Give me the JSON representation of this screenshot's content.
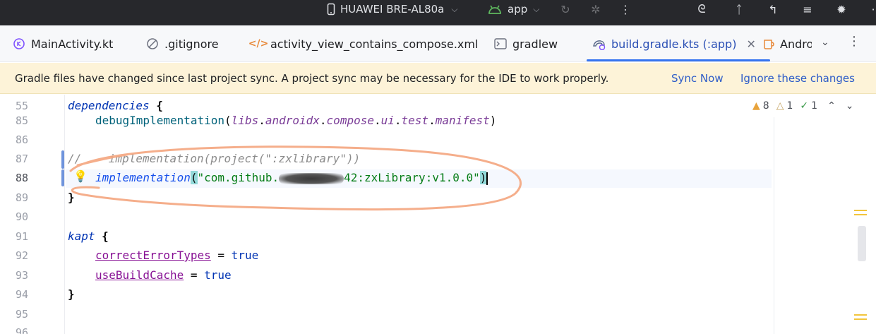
{
  "toolbar": {
    "device": "HUAWEI BRE-AL80a",
    "run_config": "app"
  },
  "tabs": [
    {
      "label": "MainActivity.kt",
      "icon": "kotlin-file-icon"
    },
    {
      "label": ".gitignore",
      "icon": "ignore-file-icon"
    },
    {
      "label": "activity_view_contains_compose.xml",
      "icon": "xml-file-icon"
    },
    {
      "label": "gradlew",
      "icon": "shell-file-icon"
    },
    {
      "label": "build.gradle.kts (:app)",
      "icon": "gradle-kotlin-file-icon",
      "active": true
    },
    {
      "label": "Andro",
      "icon": "android-manifest-icon"
    }
  ],
  "banner": {
    "message": "Gradle files have changed since last project sync. A project sync may be necessary for the IDE to work properly.",
    "sync_now": "Sync Now",
    "ignore": "Ignore these changes"
  },
  "inspections": {
    "warnings": "8",
    "weak_warnings": "1",
    "typos": "1"
  },
  "editor": {
    "line_numbers": [
      "55",
      "85",
      "86",
      "87",
      "88",
      "89",
      "90",
      "91",
      "92",
      "93",
      "94",
      "95",
      "96"
    ],
    "current_line": "88",
    "lines": {
      "l55": {
        "kw": "dependencies",
        "rest": " {"
      },
      "l85": {
        "fn": "debugImplementation",
        "open": "(",
        "a": "libs",
        "b": "androidx",
        "c": "compose",
        "d": "ui",
        "e": "test",
        "f": "manifest",
        "close": ")",
        "dot": "."
      },
      "l87": "//    implementation(project(\":zxlibrary\"))",
      "l88": {
        "fn": "implementation",
        "open": "(",
        "str_a": "\"com.github.",
        "str_b": "42:zxLibrary:v1.0.0\"",
        "close": ")"
      },
      "l89": "}",
      "l91": {
        "kw": "kapt",
        "rest": " {"
      },
      "l92": {
        "prop": "correctErrorTypes",
        "eq": " = ",
        "val": "true"
      },
      "l93": {
        "prop": "useBuildCache",
        "eq": " = ",
        "val": "true"
      },
      "l94": "}"
    }
  },
  "colors": {
    "accent": "#3574f0",
    "banner_bg": "#fdf3d8",
    "annotation_stroke": "#f4a57e"
  }
}
